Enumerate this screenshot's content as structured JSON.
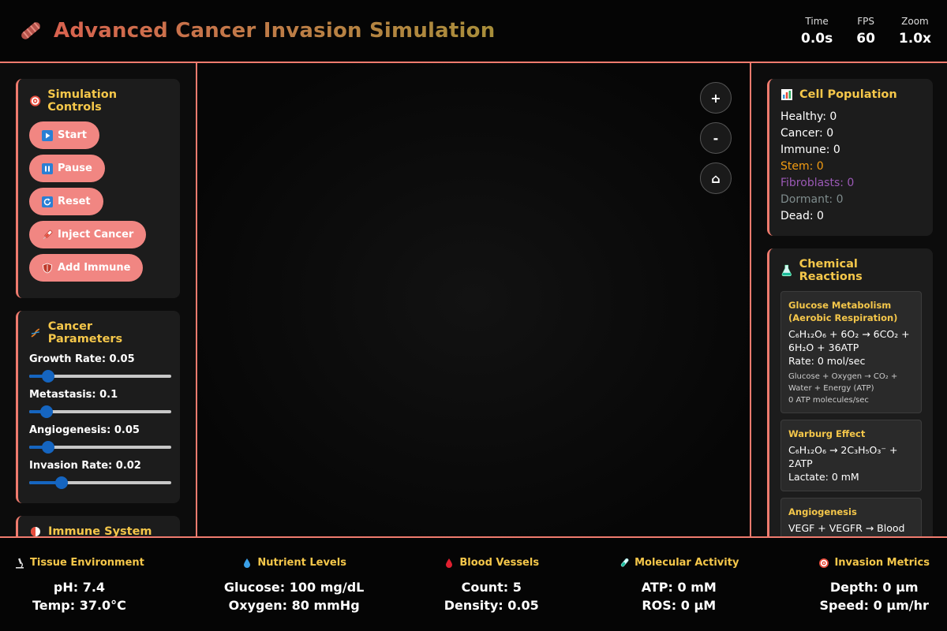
{
  "header": {
    "title": "Advanced Cancer Invasion Simulation",
    "icon": "dna-icon",
    "stats": [
      {
        "label": "Time",
        "value": "0.0s"
      },
      {
        "label": "FPS",
        "value": "60"
      },
      {
        "label": "Zoom",
        "value": "1.0x"
      }
    ]
  },
  "controls": {
    "title": "Simulation Controls",
    "buttons": [
      {
        "label": "Start",
        "icon": "play-icon"
      },
      {
        "label": "Pause",
        "icon": "pause-icon"
      },
      {
        "label": "Reset",
        "icon": "reset-icon"
      },
      {
        "label": "Inject Cancer",
        "icon": "syringe-icon"
      },
      {
        "label": "Add Immune",
        "icon": "shield-icon"
      }
    ]
  },
  "cancer_params": {
    "title": "Cancer Parameters",
    "sliders": [
      {
        "label": "Growth Rate: 0.05",
        "value": 0.05,
        "min": 0,
        "max": 0.5
      },
      {
        "label": "Metastasis: 0.1",
        "value": 0.1,
        "min": 0,
        "max": 1.2
      },
      {
        "label": "Angiogenesis: 0.05",
        "value": 0.05,
        "min": 0,
        "max": 0.5
      },
      {
        "label": "Invasion Rate: 0.02",
        "value": 0.02,
        "min": 0,
        "max": 0.1
      }
    ]
  },
  "immune_panel": {
    "title": "Immune System"
  },
  "zoom_controls": {
    "zoom_in": "+",
    "zoom_out": "-",
    "home": "⌂"
  },
  "population": {
    "title": "Cell Population",
    "items": [
      {
        "label": "Healthy: 0",
        "color": "#ffffff"
      },
      {
        "label": "Cancer: 0",
        "color": "#ffffff"
      },
      {
        "label": "Immune: 0",
        "color": "#ffffff"
      },
      {
        "label": "Stem: 0",
        "color": "#f39c12"
      },
      {
        "label": "Fibroblasts: 0",
        "color": "#9b59b6"
      },
      {
        "label": "Dormant: 0",
        "color": "#7f8c8d"
      },
      {
        "label": "Dead: 0",
        "color": "#ffffff"
      }
    ]
  },
  "reactions": {
    "title": "Chemical Reactions",
    "items": [
      {
        "title": "Glucose Metabolism (Aerobic Respiration)",
        "equation": "C₆H₁₂O₆ + 6O₂ → 6CO₂ + 6H₂O + 36ATP",
        "rate": "Rate: 0 mol/sec",
        "desc": "Glucose + Oxygen → CO₂ + Water + Energy (ATP)",
        "desc2": "0 ATP molecules/sec"
      },
      {
        "title": "Warburg Effect",
        "equation": "C₆H₁₂O₆ → 2C₃H₅O₃⁻ + 2ATP",
        "rate": "Lactate: 0 mM"
      },
      {
        "title": "Angiogenesis",
        "equation": "VEGF + VEGFR → Blood Vessel Growth"
      }
    ]
  },
  "bottom": [
    {
      "title": "Tissue Environment",
      "icon": "microscope-icon",
      "lines": [
        "pH: 7.4",
        "Temp: 37.0°C"
      ]
    },
    {
      "title": "Nutrient Levels",
      "icon": "droplet-icon",
      "lines": [
        "Glucose: 100 mg/dL",
        "Oxygen: 80 mmHg"
      ]
    },
    {
      "title": "Blood Vessels",
      "icon": "blood-drop-icon",
      "lines": [
        "Count: 5",
        "Density: 0.05"
      ]
    },
    {
      "title": "Molecular Activity",
      "icon": "test-tube-icon",
      "lines": [
        "ATP: 0 mM",
        "ROS: 0 μM"
      ]
    },
    {
      "title": "Invasion Metrics",
      "icon": "target-icon",
      "lines": [
        "Depth: 0 μm",
        "Speed: 0 μm/hr"
      ]
    }
  ]
}
